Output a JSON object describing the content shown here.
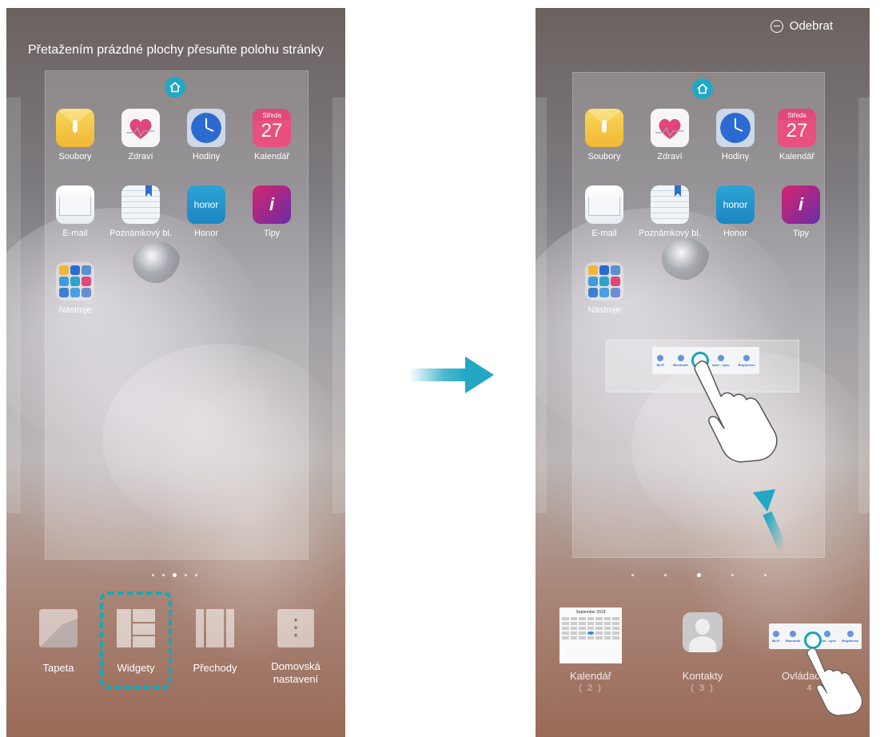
{
  "left_screen": {
    "hint": "Přetažením prázdné plochy přesuňte polohu stránky",
    "apps": [
      {
        "label": "Soubory",
        "icon": "files-icon"
      },
      {
        "label": "Zdraví",
        "icon": "health-icon"
      },
      {
        "label": "Hodiny",
        "icon": "clock-icon"
      },
      {
        "label": "Kalendář",
        "icon": "calendar-icon"
      },
      {
        "label": "E-mail",
        "icon": "email-icon"
      },
      {
        "label": "Poznámkový bl.",
        "icon": "notepad-icon"
      },
      {
        "label": "Honor",
        "icon": "honor-icon"
      },
      {
        "label": "Tipy",
        "icon": "tips-icon"
      },
      {
        "label": "Nástroje",
        "icon": "tools-folder-icon"
      }
    ],
    "calendar_icon": {
      "day_name": "Středa",
      "day_number": "27"
    },
    "honor_icon_text": "honor",
    "tips_icon_text": "i",
    "dock": [
      {
        "label": "Tapeta",
        "icon": "wallpaper-icon"
      },
      {
        "label": "Widgety",
        "icon": "widgets-icon"
      },
      {
        "label": "Přechody",
        "icon": "transitions-icon"
      },
      {
        "label": "Domovská nastavení",
        "icon": "home-settings-icon"
      }
    ],
    "highlight_color": "#1aa6b4"
  },
  "right_screen": {
    "remove_label": "Odebrat",
    "apps": [
      {
        "label": "Soubory"
      },
      {
        "label": "Zdraví"
      },
      {
        "label": "Hodiny"
      },
      {
        "label": "Kalendář"
      },
      {
        "label": "E-mail"
      },
      {
        "label": "Poznámkový bl."
      },
      {
        "label": "Honor"
      },
      {
        "label": "Tipy"
      },
      {
        "label": "Nástroje"
      }
    ],
    "widget_panel": {
      "items": [
        "Wi-Fi",
        "Bluetooth",
        "",
        "Auto - sync",
        "Brightness"
      ]
    },
    "widgets": [
      {
        "label": "Kalendář",
        "count": "( 2 )"
      },
      {
        "label": "Kontakty",
        "count": "( 3 )"
      },
      {
        "label": "Ovládací p",
        "count": "4 ("
      }
    ],
    "calendar_widget_title": "September 2018"
  },
  "accent_color": "#22a7c4"
}
